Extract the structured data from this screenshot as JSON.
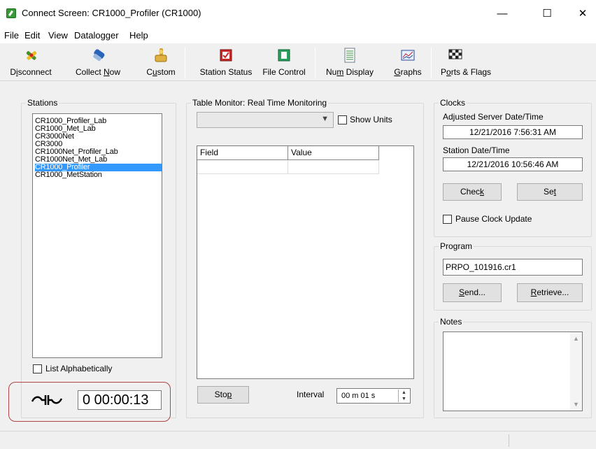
{
  "window": {
    "title": "Connect Screen: CR1000_Profiler (CR1000)",
    "minimize": "—",
    "maximize": "☐",
    "close": "✕"
  },
  "menu": [
    "File",
    "Edit",
    "View",
    "Datalogger",
    "Help"
  ],
  "toolbar": [
    {
      "label_pre": "D",
      "label_u": "i",
      "label_post": "sconnect",
      "icon": "disconnect-plug-icon"
    },
    {
      "label_pre": "Collect ",
      "label_u": "N",
      "label_post": "ow",
      "icon": "collect-now-icon"
    },
    {
      "label_pre": "C",
      "label_u": "u",
      "label_post": "stom",
      "icon": "custom-icon"
    },
    {
      "label_pre": "Station Status",
      "label_u": "",
      "label_post": "",
      "icon": "station-status-icon"
    },
    {
      "label_pre": "File Control",
      "label_u": "",
      "label_post": "",
      "icon": "file-control-icon"
    },
    {
      "label_pre": "Nu",
      "label_u": "m",
      "label_post": " Display",
      "icon": "num-display-icon"
    },
    {
      "label_pre": "",
      "label_u": "G",
      "label_post": "raphs",
      "icon": "graphs-icon"
    },
    {
      "label_pre": "P",
      "label_u": "o",
      "label_post": "rts & Flags",
      "icon": "ports-flags-icon"
    }
  ],
  "stations": {
    "title": "Stations",
    "items": [
      "CR1000_Profiler_Lab",
      "CR1000_Met_Lab",
      "CR3000Net",
      "CR3000",
      "CR1000Net_Profiler_Lab",
      "CR1000Net_Met_Lab",
      "CR1000_Profiler",
      "CR1000_MetStation"
    ],
    "selected_index": 6,
    "list_alpha_label": "List Alphabetically",
    "list_alpha_checked": false,
    "connection_time": "0 00:00:13"
  },
  "table_monitor": {
    "title": "Table Monitor: Real Time Monitoring",
    "dropdown_value": "",
    "show_units_label": "Show Units",
    "show_units_checked": false,
    "columns": [
      "Field",
      "Value"
    ],
    "stop_label_pre": "Sto",
    "stop_label_u": "p",
    "interval_label": "Interval",
    "interval_value": "00 m 01 s"
  },
  "clocks": {
    "title": "Clocks",
    "server_label": "Adjusted Server Date/Time",
    "server_value": "12/21/2016 7:56:31 AM",
    "station_label": "Station Date/Time",
    "station_value": "12/21/2016 10:56:46 AM",
    "check_pre": "Chec",
    "check_u": "k",
    "set_pre": "Se",
    "set_u": "t",
    "pause_label": "Pause Clock Update",
    "pause_checked": false
  },
  "program": {
    "title": "Program",
    "file": "PRPO_101916.cr1",
    "send_u": "S",
    "send_post": "end...",
    "retrieve_u": "R",
    "retrieve_post": "etrieve..."
  },
  "notes": {
    "title": "Notes",
    "value": ""
  },
  "colors": {
    "selection": "#3399ff",
    "highlight_ring": "#b04545"
  }
}
